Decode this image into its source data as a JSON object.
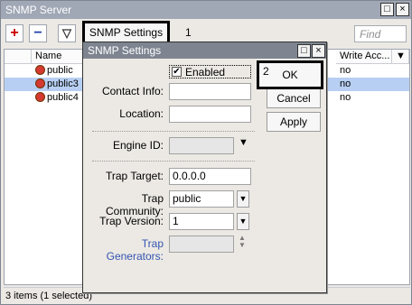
{
  "main_window": {
    "title": "SNMP Server",
    "min_glyph": "□",
    "close_glyph": "×"
  },
  "toolbar": {
    "add_glyph": "+",
    "remove_glyph": "−",
    "filter_glyph": "▽",
    "snmp_settings_label": "SNMP Settings",
    "marker_1": "1",
    "find_placeholder": "Find"
  },
  "table": {
    "columns": [
      "Name",
      "Write Acc...",
      "▼"
    ],
    "rows": [
      {
        "name": "public",
        "write_access": "no",
        "selected": false
      },
      {
        "name": "public3",
        "write_access": "no",
        "selected": true
      },
      {
        "name": "public4",
        "write_access": "no",
        "selected": false
      }
    ]
  },
  "status_bar": {
    "text": "3 items (1 selected)"
  },
  "dialog": {
    "title": "SNMP Settings",
    "min_glyph": "□",
    "close_glyph": "×",
    "enabled_label": "Enabled",
    "enabled_checked": true,
    "contact_info_label": "Contact Info:",
    "contact_info_value": "",
    "location_label": "Location:",
    "location_value": "",
    "engine_id_label": "Engine ID:",
    "engine_id_value": "",
    "trap_target_label": "Trap Target:",
    "trap_target_value": "0.0.0.0",
    "trap_community_label": "Trap Community:",
    "trap_community_value": "public",
    "trap_version_label": "Trap Version:",
    "trap_version_value": "1",
    "trap_generators_label": "Trap Generators:",
    "trap_generators_value": "",
    "ok_label": "OK",
    "marker_2": "2",
    "cancel_label": "Cancel",
    "apply_label": "Apply"
  },
  "icons": {
    "user": "user-icon",
    "add": "plus-icon",
    "remove": "minus-icon",
    "filter": "filter-icon",
    "dropdown": "dropdown-arrow-icon"
  },
  "colors": {
    "window_title_bg": "#a0a7b5",
    "dialog_title_bg": "#7e8591",
    "selection_bg": "#b7cff2",
    "add_icon": "#c80000",
    "remove_icon": "#1f3fa8",
    "link_text": "#3555b0"
  }
}
